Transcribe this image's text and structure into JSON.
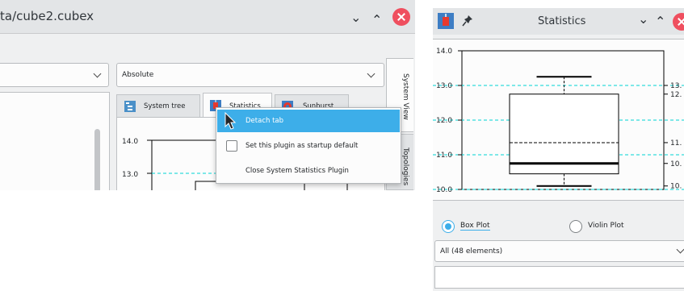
{
  "main_window": {
    "title": "ta/cube2.cubex",
    "metric_combo_value": "",
    "mode_combo_value": "Absolute",
    "side_tabs": {
      "system_view": "System View",
      "topologies": "Topologies"
    },
    "tabs": [
      {
        "label": "System tree"
      },
      {
        "label": "Statistics"
      },
      {
        "label": "Sunburst"
      }
    ],
    "mini_plot_ticks": [
      "14.0",
      "13.0"
    ],
    "context_menu": {
      "items": [
        {
          "label": "Detach tab",
          "highlighted": true
        },
        {
          "label": "Set this plugin as startup default",
          "checkbox": true
        },
        {
          "label": "Close System Statistics Plugin"
        }
      ]
    }
  },
  "stats_window": {
    "title": "Statistics",
    "radio_box_plot": "Box Plot",
    "radio_violin_plot": "Violin Plot",
    "selected_plot": "Box Plot",
    "elements_combo_value": "All (48 elements)",
    "right_axis_ticks": [
      "13.",
      "12.",
      "11.",
      "10.",
      "10."
    ]
  },
  "chart_data": {
    "type": "box",
    "title": "",
    "xlabel": "",
    "ylabel": "",
    "ylim": [
      10.0,
      14.0
    ],
    "y_ticks": [
      "14.0",
      "13.0",
      "12.0",
      "11.0",
      "10.0"
    ],
    "grid": true,
    "series": [
      {
        "whisker_max": 13.25,
        "q3": 12.75,
        "mean": 11.35,
        "median": 10.75,
        "q1": 10.45,
        "whisker_min": 10.1
      }
    ],
    "reference_lines": [
      13.0,
      12.0,
      11.0,
      10.0
    ]
  },
  "colors": {
    "accent": "#3daee9",
    "close": "#ef4f5f",
    "grid": "#00d4d4"
  },
  "icons": [
    "chevron-down-icon",
    "chevron-up-icon",
    "close-icon",
    "plugin-icon",
    "pin-icon",
    "cursor-icon"
  ]
}
